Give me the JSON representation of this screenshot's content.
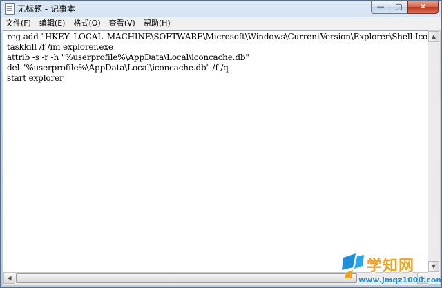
{
  "window": {
    "title": "无标题 - 记事本",
    "buttons": {
      "minimize": "—",
      "maximize": "▢",
      "close": "✕"
    }
  },
  "menu": [
    {
      "label": "文件(F)"
    },
    {
      "label": "编辑(E)"
    },
    {
      "label": "格式(O)"
    },
    {
      "label": "查看(V)"
    },
    {
      "label": "帮助(H)"
    }
  ],
  "editor": {
    "lines": [
      "reg add \"HKEY_LOCAL_MACHINE\\SOFTWARE\\Microsoft\\Windows\\CurrentVersion\\Explorer\\Shell Icons\"",
      "taskkill /f /im explorer.exe",
      "attrib -s -r -h \"%userprofile%\\AppData\\Local\\iconcache.db\"",
      "del \"%userprofile%\\AppData\\Local\\iconcache.db\" /f /q",
      "start explorer"
    ]
  },
  "scrollbar": {
    "up_arrow": "▲",
    "down_arrow": "▼",
    "left_arrow": "◀",
    "right_arrow": "▶"
  },
  "watermark": {
    "brand": "学知网",
    "url": "www.jmqz1000.com"
  }
}
